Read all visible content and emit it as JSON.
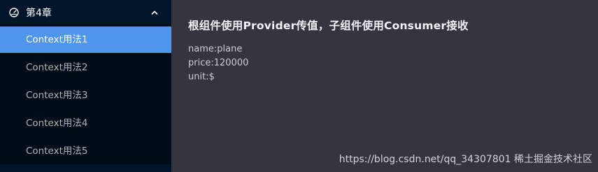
{
  "sidebar": {
    "submenu_title": "第4章",
    "items": [
      {
        "label": "Context用法1",
        "active": true
      },
      {
        "label": "Context用法2",
        "active": false
      },
      {
        "label": "Context用法3",
        "active": false
      },
      {
        "label": "Context用法4",
        "active": false
      },
      {
        "label": "Context用法5",
        "active": false
      }
    ]
  },
  "main": {
    "title": "根组件使用Provider传值，子组件使用Consumer接收",
    "lines": [
      "name:plane",
      "price:120000",
      "unit:$"
    ]
  },
  "watermark": "https://blog.csdn.net/qq_34307801 稀土掘金技术社区",
  "colors": {
    "sidebar_bg": "#001529",
    "submenu_bg": "#000c17",
    "active_item": "#4f95ec",
    "content_bg": "#35343f"
  }
}
